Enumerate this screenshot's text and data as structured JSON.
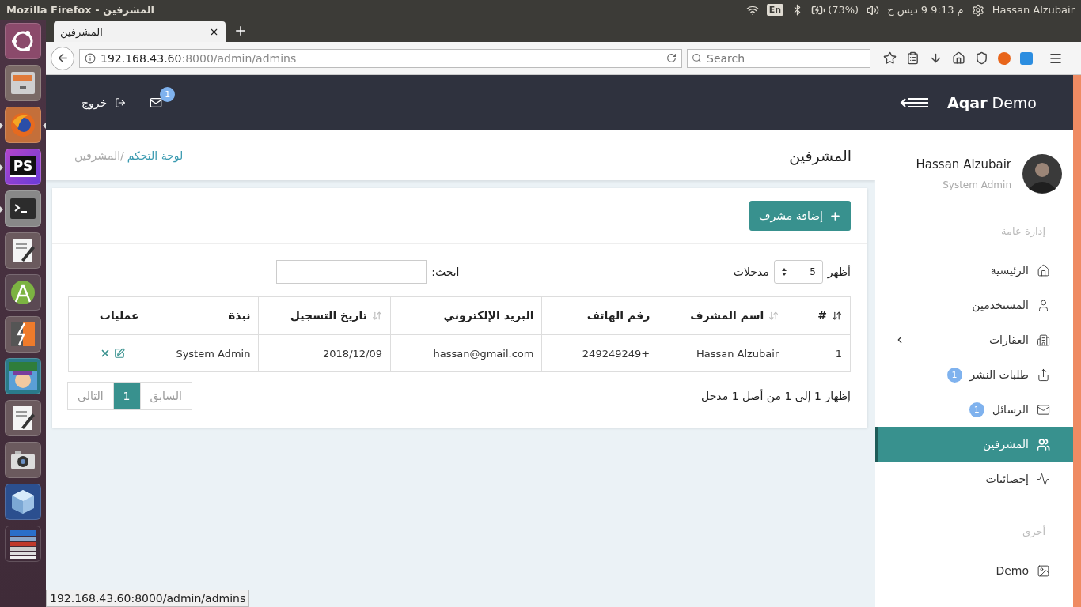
{
  "system_bar": {
    "title": "Mozilla Firefox - المشرفين",
    "keyboard": "En",
    "battery": "(73%)",
    "clock": "م 9:13 9 ديس ح",
    "user": "Hassan Alzubair"
  },
  "launcher": [
    {
      "kind": "ubuntu",
      "running": false,
      "focused": false
    },
    {
      "kind": "files",
      "running": false,
      "focused": false
    },
    {
      "kind": "firefox",
      "running": true,
      "focused": true
    },
    {
      "kind": "phpstorm",
      "label": "PS",
      "running": true,
      "focused": false
    },
    {
      "kind": "terminal",
      "running": true,
      "focused": false
    },
    {
      "kind": "editor",
      "running": false,
      "focused": false
    },
    {
      "kind": "android",
      "running": false,
      "focused": false
    },
    {
      "kind": "flash",
      "running": false,
      "focused": false
    },
    {
      "kind": "game",
      "running": false,
      "focused": false
    },
    {
      "kind": "editor",
      "running": false,
      "focused": false
    },
    {
      "kind": "camera",
      "running": false,
      "focused": false
    },
    {
      "kind": "cube",
      "running": false,
      "focused": false
    },
    {
      "kind": "stack",
      "running": false,
      "focused": false
    }
  ],
  "browser": {
    "tab_title": "المشرفين",
    "url": {
      "host": "192.168.43.60",
      "rest": ":8000/admin/admins"
    },
    "search_placeholder": "Search"
  },
  "header": {
    "brand": "**Aqar** Demo",
    "mail_badge": "1",
    "logout": "خروج"
  },
  "page": {
    "title": "المشرفين",
    "breadcrumb": [
      {
        "label": "لوحة التحكم",
        "link": true
      },
      {
        "label": "/المشرفين",
        "link": false
      }
    ]
  },
  "card": {
    "add_button": "إضافة مشرف",
    "show_label": "أظهر",
    "page_size": "5",
    "entries_label": "مدخلات",
    "search_label": "ابحث:",
    "table": {
      "columns": [
        {
          "label": "#",
          "sortable": true,
          "sorted": true
        },
        {
          "label": "اسم المشرف",
          "sortable": true,
          "sorted": false
        },
        {
          "label": "رقم الهاتف",
          "sortable": false
        },
        {
          "label": "البريد الإلكتروني",
          "sortable": false
        },
        {
          "label": "تاريخ التسجيل",
          "sortable": true,
          "sorted": false
        },
        {
          "label": "نبذة",
          "sortable": false
        },
        {
          "label": "عمليات",
          "sortable": false
        }
      ],
      "rows": [
        [
          "1",
          "Hassan Alzubair",
          "+249249249",
          "hassan@gmail.com",
          "2018/12/09",
          "System Admin"
        ]
      ]
    },
    "info": "إظهار 1 إلى 1 من أصل 1 مدخل",
    "pagination": [
      {
        "label": "السابق",
        "selected": false
      },
      {
        "label": "1",
        "selected": true
      },
      {
        "label": "التالي",
        "selected": false
      }
    ]
  },
  "sidebar": {
    "name": "Hassan Alzubair",
    "role": "System Admin",
    "sections": [
      {
        "title": "إدارة عامة",
        "items": [
          {
            "label": "الرئيسية",
            "kind": "home",
            "selected": false
          },
          {
            "label": "المستخدمين",
            "kind": "user",
            "selected": false
          },
          {
            "label": "العقارات",
            "kind": "building",
            "selected": false,
            "expandable": true
          },
          {
            "label": "طلبات النشر",
            "kind": "share",
            "selected": false,
            "badge": "1"
          },
          {
            "label": "الرسائل",
            "kind": "mail",
            "selected": false,
            "badge": "1"
          },
          {
            "label": "المشرفين",
            "kind": "users",
            "selected": true
          },
          {
            "label": "إحصائيات",
            "kind": "stats",
            "selected": false
          }
        ]
      },
      {
        "title": "أخرى",
        "items": [
          {
            "label": "Demo",
            "kind": "image",
            "selected": false
          }
        ]
      }
    ]
  },
  "status_url": "192.168.43.60:8000/admin/admins"
}
